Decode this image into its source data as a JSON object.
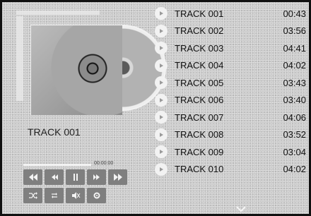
{
  "player": {
    "now_playing_title": "TRACK 001",
    "time_display": "00:00:00"
  },
  "controls": [
    {
      "name": "rewind-fast-button",
      "icon": "fast-rewind-icon"
    },
    {
      "name": "previous-button",
      "icon": "previous-icon"
    },
    {
      "name": "pause-button",
      "icon": "pause-icon"
    },
    {
      "name": "next-button",
      "icon": "next-icon"
    },
    {
      "name": "forward-fast-button",
      "icon": "fast-forward-icon"
    },
    {
      "name": "shuffle-button",
      "icon": "shuffle-icon"
    },
    {
      "name": "repeat-button",
      "icon": "repeat-icon"
    },
    {
      "name": "mute-button",
      "icon": "mute-icon"
    },
    {
      "name": "settings-button",
      "icon": "gear-icon"
    }
  ],
  "playlist": [
    {
      "title": "TRACK 001",
      "duration": "00:43"
    },
    {
      "title": "TRACK 002",
      "duration": "03:56"
    },
    {
      "title": "TRACK 003",
      "duration": "04:41"
    },
    {
      "title": "TRACK 004",
      "duration": "04:02"
    },
    {
      "title": "TRACK 005",
      "duration": "03:43"
    },
    {
      "title": "TRACK 006",
      "duration": "03:40"
    },
    {
      "title": "TRACK 007",
      "duration": "04:06"
    },
    {
      "title": "TRACK 008",
      "duration": "03:52"
    },
    {
      "title": "TRACK 009",
      "duration": "03:04"
    },
    {
      "title": "TRACK 010",
      "duration": "04:02"
    }
  ],
  "colors": {
    "background": "#c9c9c9",
    "button": "#7f7f7f",
    "text": "#111111",
    "border": "#111111"
  }
}
